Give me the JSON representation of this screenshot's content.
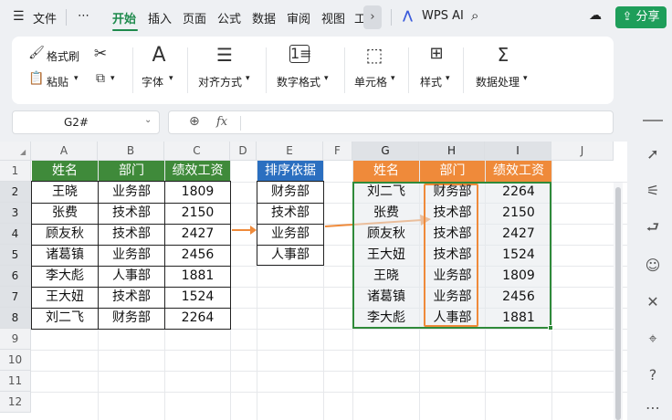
{
  "menubar": {
    "file_label": "文件",
    "more": "⋯",
    "tabs": [
      "开始",
      "插入",
      "页面",
      "公式",
      "数据",
      "审阅",
      "视图",
      "工"
    ],
    "active_tab": "开始",
    "wps_ai": "WPS AI",
    "share": "分享"
  },
  "ribbon": {
    "format_painter": "格式刷",
    "paste": "粘贴",
    "groups": [
      "字体",
      "对齐方式",
      "数字格式",
      "单元格",
      "样式",
      "数据处理"
    ]
  },
  "formula_bar": {
    "cell_ref": "G2#",
    "fx": "fx",
    "content": ""
  },
  "columns": [
    "A",
    "B",
    "C",
    "D",
    "E",
    "F",
    "G",
    "H",
    "I",
    "J"
  ],
  "rows": [
    "1",
    "2",
    "3",
    "4",
    "5",
    "6",
    "7",
    "8",
    "9",
    "10",
    "11",
    "12"
  ],
  "source_table": {
    "headers": [
      "姓名",
      "部门",
      "绩效工资"
    ],
    "rows": [
      [
        "王晓",
        "业务部",
        "1809"
      ],
      [
        "张费",
        "技术部",
        "2150"
      ],
      [
        "顾友秋",
        "技术部",
        "2427"
      ],
      [
        "诸葛镇",
        "业务部",
        "2456"
      ],
      [
        "李大彪",
        "人事部",
        "1881"
      ],
      [
        "王大妞",
        "技术部",
        "1524"
      ],
      [
        "刘二飞",
        "财务部",
        "2264"
      ]
    ]
  },
  "sort_basis": {
    "header": "排序依据",
    "items": [
      "财务部",
      "技术部",
      "业务部",
      "人事部"
    ]
  },
  "result_table": {
    "headers": [
      "姓名",
      "部门",
      "绩效工资"
    ],
    "rows": [
      [
        "刘二飞",
        "财务部",
        "2264"
      ],
      [
        "张费",
        "技术部",
        "2150"
      ],
      [
        "顾友秋",
        "技术部",
        "2427"
      ],
      [
        "王大妞",
        "技术部",
        "1524"
      ],
      [
        "王晓",
        "业务部",
        "1809"
      ],
      [
        "诸葛镇",
        "业务部",
        "2456"
      ],
      [
        "李大彪",
        "人事部",
        "1881"
      ]
    ]
  },
  "colors": {
    "green_header": "#3f8a3a",
    "blue_header": "#2b6fc0",
    "orange_header": "#ef8a3a",
    "accent": "#1e8a4c"
  }
}
